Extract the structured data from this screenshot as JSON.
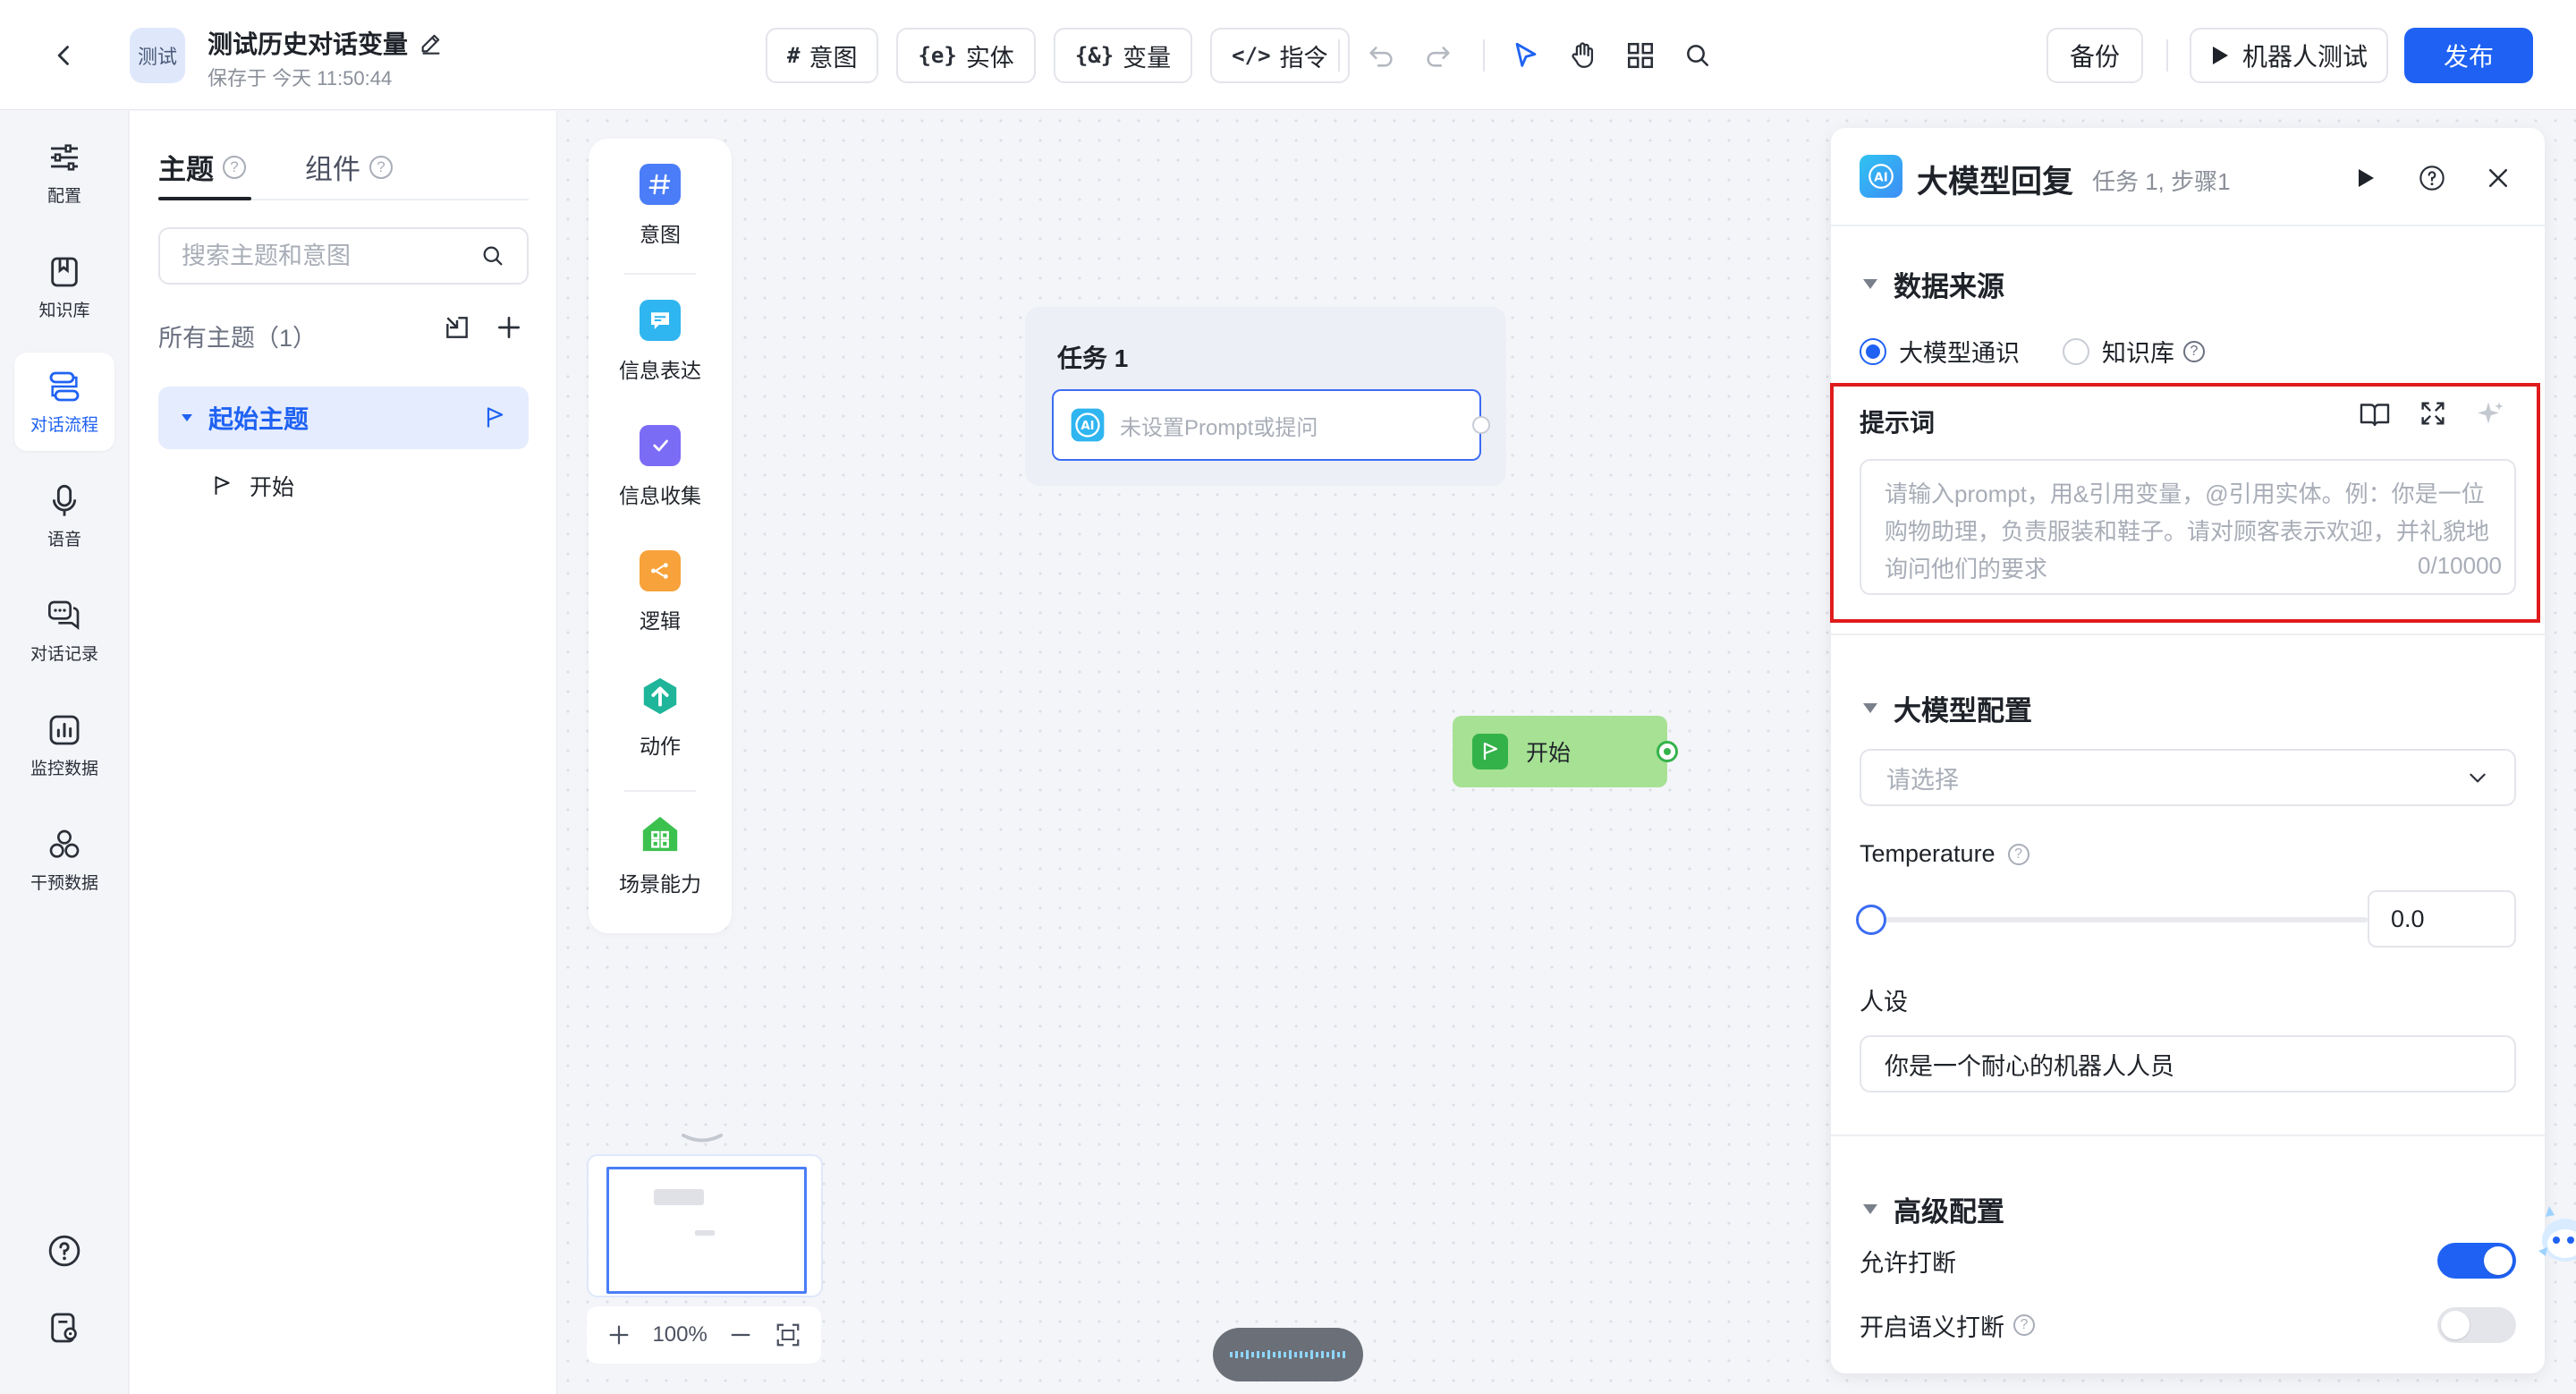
{
  "header": {
    "app_avatar": "测试",
    "title": "测试历史对话变量",
    "saved": "保存于 今天 11:50:44",
    "tools": [
      {
        "glyph": "#",
        "label": "意图"
      },
      {
        "glyph": "{e}",
        "label": "实体"
      },
      {
        "glyph": "{&}",
        "label": "变量"
      },
      {
        "glyph": "</>",
        "label": "指令"
      }
    ],
    "backup": "备份",
    "robot_test": "机器人测试",
    "publish": "发布",
    "accent": "#1f62f3"
  },
  "rail": {
    "items": [
      {
        "label": "配置",
        "icon": "sliders-icon"
      },
      {
        "label": "知识库",
        "icon": "bookmark-icon"
      },
      {
        "label": "对话流程",
        "icon": "flow-icon",
        "active": true
      },
      {
        "label": "语音",
        "icon": "microphone-icon"
      },
      {
        "label": "对话记录",
        "icon": "chat-icon"
      },
      {
        "label": "监控数据",
        "icon": "chart-icon"
      },
      {
        "label": "干预数据",
        "icon": "circles-icon"
      }
    ]
  },
  "topics": {
    "tab_topic": "主题",
    "tab_component": "组件",
    "search_placeholder": "搜索主题和意图",
    "all_topics": "所有主题（1）",
    "topic_name": "起始主题",
    "sub_item": "开始"
  },
  "palette": {
    "items": [
      {
        "label": "意图",
        "icon": "hash-icon",
        "color": "#4a7df7"
      },
      {
        "label": "信息表达",
        "icon": "message-icon",
        "color": "#2fb5f0"
      },
      {
        "label": "信息收集",
        "icon": "form-check-icon",
        "color": "#7b6cf6"
      },
      {
        "label": "逻辑",
        "icon": "branch-icon",
        "color": "#f7a23b"
      },
      {
        "label": "动作",
        "icon": "arrow-up-hex-icon",
        "color": "#1fb59a"
      },
      {
        "label": "场景能力",
        "icon": "house-grid-icon",
        "color": "#3cc14e"
      }
    ]
  },
  "canvas": {
    "task_title": "任务 1",
    "task_step_placeholder": "未设置Prompt或提问",
    "start_node": "开始",
    "zoom": "100%"
  },
  "panel": {
    "title": "大模型回复",
    "subtitle": "任务 1, 步骤1",
    "section_source": "数据来源",
    "source_llm": "大模型通识",
    "source_kb": "知识库",
    "prompt_label": "提示词",
    "prompt_placeholder": "请输入prompt，用&引用变量，@引用实体。例：你是一位购物助理，负责服装和鞋子。请对顾客表示欢迎，并礼貌地询问他们的要求",
    "prompt_count": "0/10000",
    "section_model": "大模型配置",
    "model_placeholder": "请选择",
    "temperature_label": "Temperature",
    "temperature_value": "0.0",
    "temperature_fraction": 0,
    "persona_label": "人设",
    "persona_value": "你是一个耐心的机器人人员",
    "section_advanced": "高级配置",
    "allow_interrupt": "允许打断",
    "allow_interrupt_on": true,
    "semantic_interrupt": "开启语义打断",
    "semantic_interrupt_on": false
  }
}
